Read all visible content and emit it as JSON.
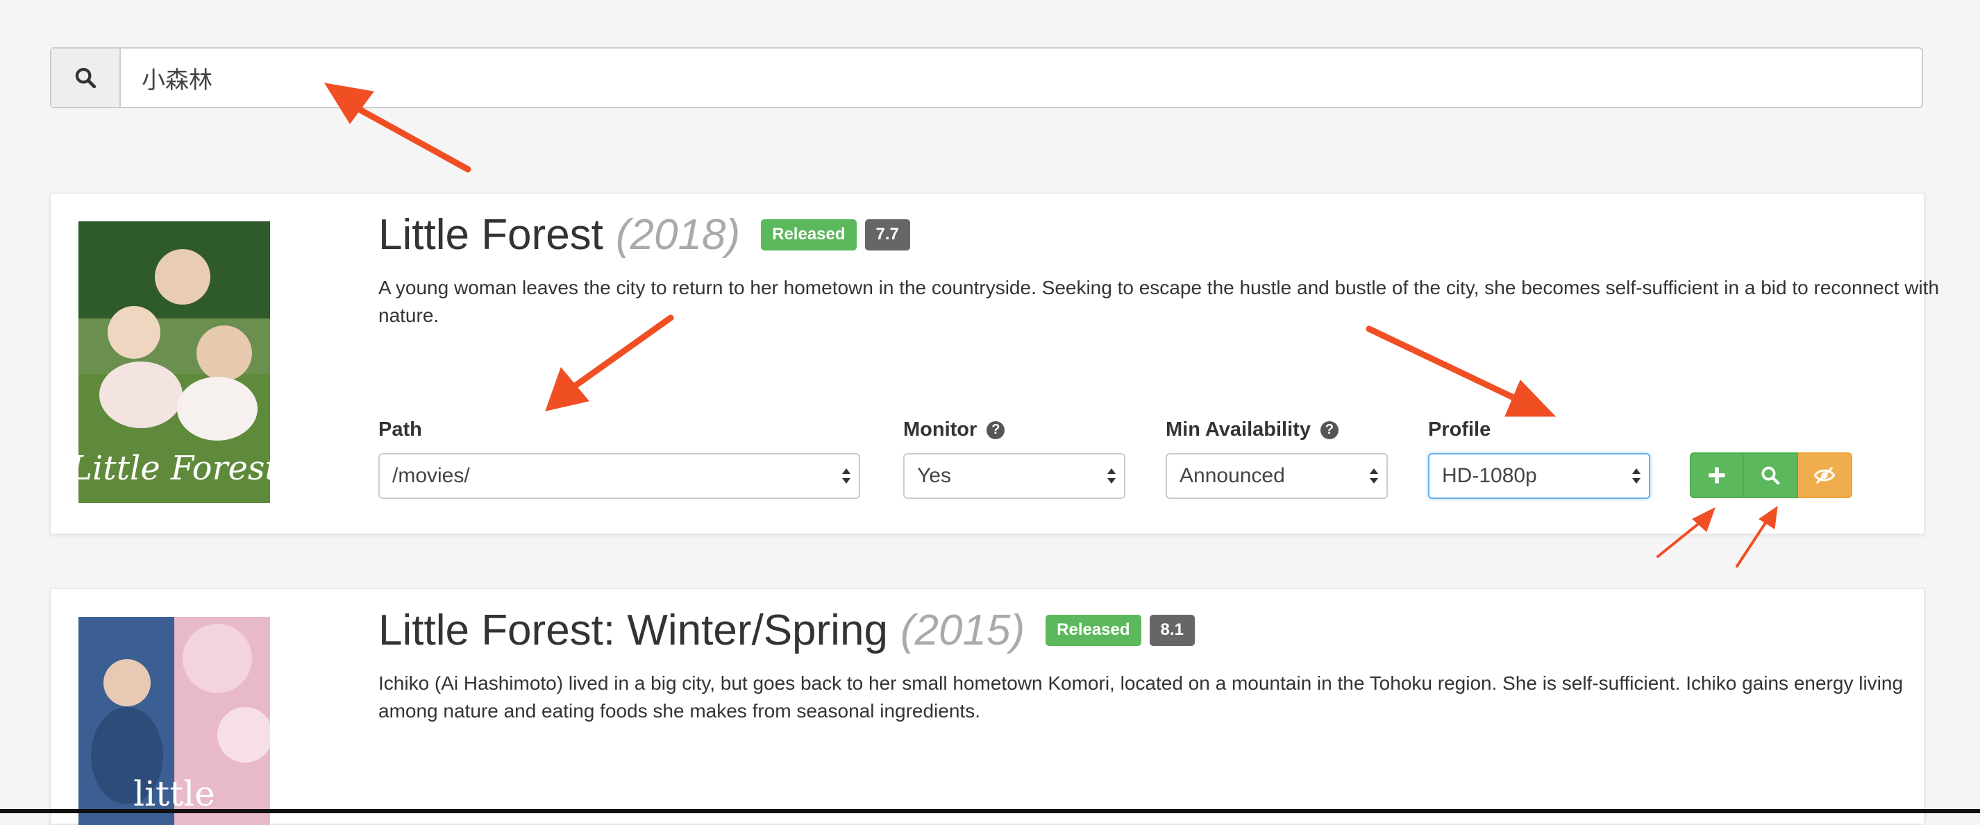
{
  "search": {
    "value": "小森林",
    "placeholder": ""
  },
  "results": [
    {
      "title": "Little Forest",
      "year": "(2018)",
      "status": "Released",
      "rating": "7.7",
      "overview": "A young woman leaves the city to return to her hometown in the countryside. Seeking to escape the hustle and bustle of the city, she becomes self-sufficient in a bid to reconnect with nature.",
      "poster_text": "Little Forest",
      "fields": {
        "path": {
          "label": "Path",
          "value": "/movies/"
        },
        "monitor": {
          "label": "Monitor",
          "value": "Yes"
        },
        "min_availability": {
          "label": "Min Availability",
          "value": "Announced"
        },
        "profile": {
          "label": "Profile",
          "value": "HD-1080p"
        }
      },
      "actions": [
        "add-icon",
        "search-icon",
        "ignore-icon"
      ]
    },
    {
      "title": "Little Forest: Winter/Spring",
      "year": "(2015)",
      "status": "Released",
      "rating": "8.1",
      "overview": "Ichiko (Ai Hashimoto) lived in a big city, but goes back to her small hometown Komori, located on a mountain in the Tohoku region. She is self-sufficient. Ichiko gains energy living among nature and eating foods she makes from seasonal ingredients.",
      "poster_text": "little"
    }
  ],
  "help_icon_glyph": "?",
  "colors": {
    "success": "#5cb85c",
    "warning": "#f0ad4e",
    "rating_badge": "#666666",
    "annotation_arrow": "#f04e23",
    "focus_border": "#66afe9"
  }
}
